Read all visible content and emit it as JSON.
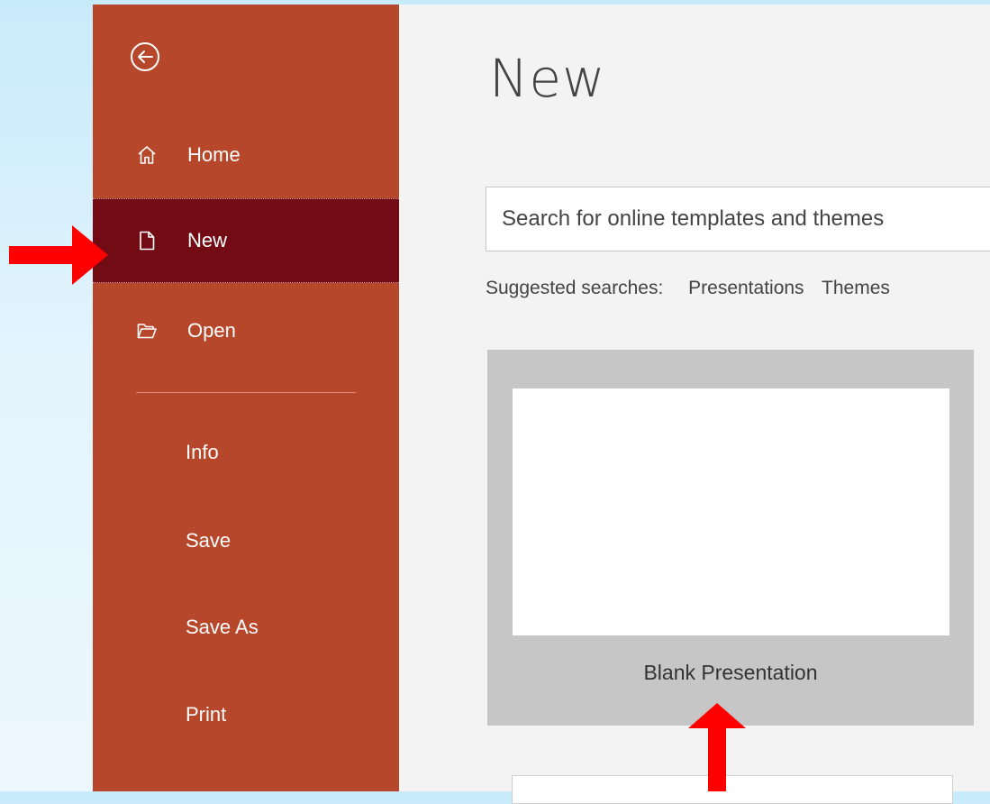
{
  "sidebar": {
    "back_label": "Back",
    "nav": [
      {
        "label": "Home",
        "icon": "home-icon"
      },
      {
        "label": "New",
        "icon": "new-document-icon",
        "selected": true
      },
      {
        "label": "Open",
        "icon": "open-folder-icon"
      }
    ],
    "secondary": [
      {
        "label": "Info"
      },
      {
        "label": "Save"
      },
      {
        "label": "Save As"
      },
      {
        "label": "Print"
      }
    ]
  },
  "main": {
    "title": "New",
    "search": {
      "value": "Search for online templates and themes"
    },
    "suggested": {
      "label": "Suggested searches:",
      "links": [
        "Presentations",
        "Themes"
      ]
    },
    "templates": [
      {
        "label": "Blank Presentation"
      }
    ]
  },
  "annotations": {
    "color": "#ff0000",
    "arrows": [
      "pointing-right-at-new",
      "pointing-up-at-blank-presentation"
    ]
  },
  "colors": {
    "sidebar": "#b7472a",
    "sidebar_selected": "#720b14",
    "content_bg": "#f3f3f3"
  }
}
